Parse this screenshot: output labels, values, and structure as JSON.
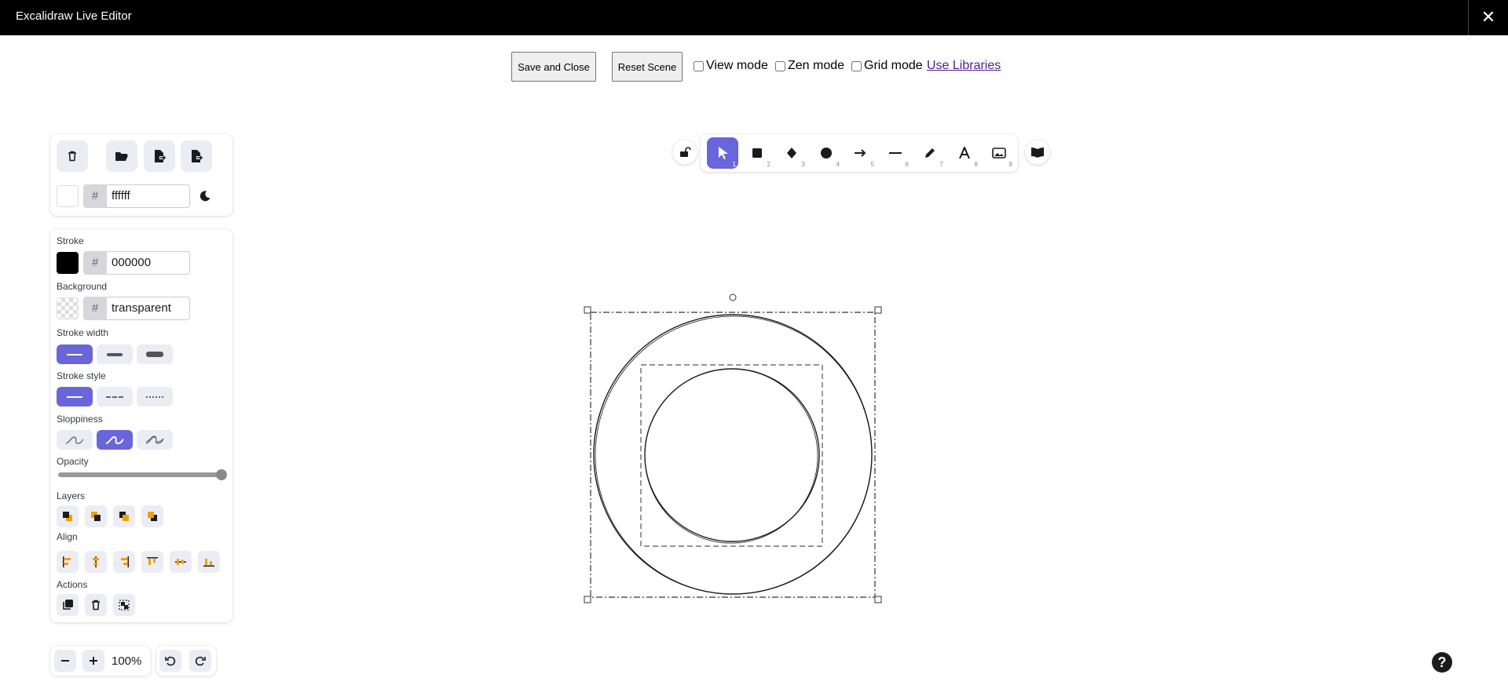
{
  "window": {
    "title": "Excalidraw Live Editor",
    "close_symbol": "✕"
  },
  "topbar": {
    "save_close": "Save and Close",
    "reset_scene": "Reset Scene",
    "view_mode": "View mode",
    "zen_mode": "Zen mode",
    "grid_mode": "Grid mode",
    "use_libraries": "Use Libraries"
  },
  "canvas_panel": {
    "background_hex": "ffffff",
    "hash": "#",
    "background_color": "#ffffff"
  },
  "properties": {
    "stroke_label": "Stroke",
    "stroke_hex": "000000",
    "stroke_color": "#000000",
    "background_label": "Background",
    "background_hex": "transparent",
    "stroke_width_label": "Stroke width",
    "stroke_width_selected": "thin",
    "stroke_style_label": "Stroke style",
    "stroke_style_selected": "solid",
    "sloppiness_label": "Sloppiness",
    "sloppiness_selected": "artist",
    "opacity_label": "Opacity",
    "opacity_value": 100,
    "layers_label": "Layers",
    "align_label": "Align",
    "actions_label": "Actions"
  },
  "shape_toolbar": {
    "tools": [
      {
        "name": "selection",
        "num": "1",
        "active": true
      },
      {
        "name": "rectangle",
        "num": "2"
      },
      {
        "name": "diamond",
        "num": "3"
      },
      {
        "name": "ellipse",
        "num": "4"
      },
      {
        "name": "arrow",
        "num": "5"
      },
      {
        "name": "line",
        "num": "6"
      },
      {
        "name": "draw",
        "num": "7"
      },
      {
        "name": "text",
        "num": "8"
      },
      {
        "name": "image",
        "num": "9"
      }
    ],
    "accent": "#6965db"
  },
  "footer": {
    "zoom": "100%",
    "help": "?"
  }
}
